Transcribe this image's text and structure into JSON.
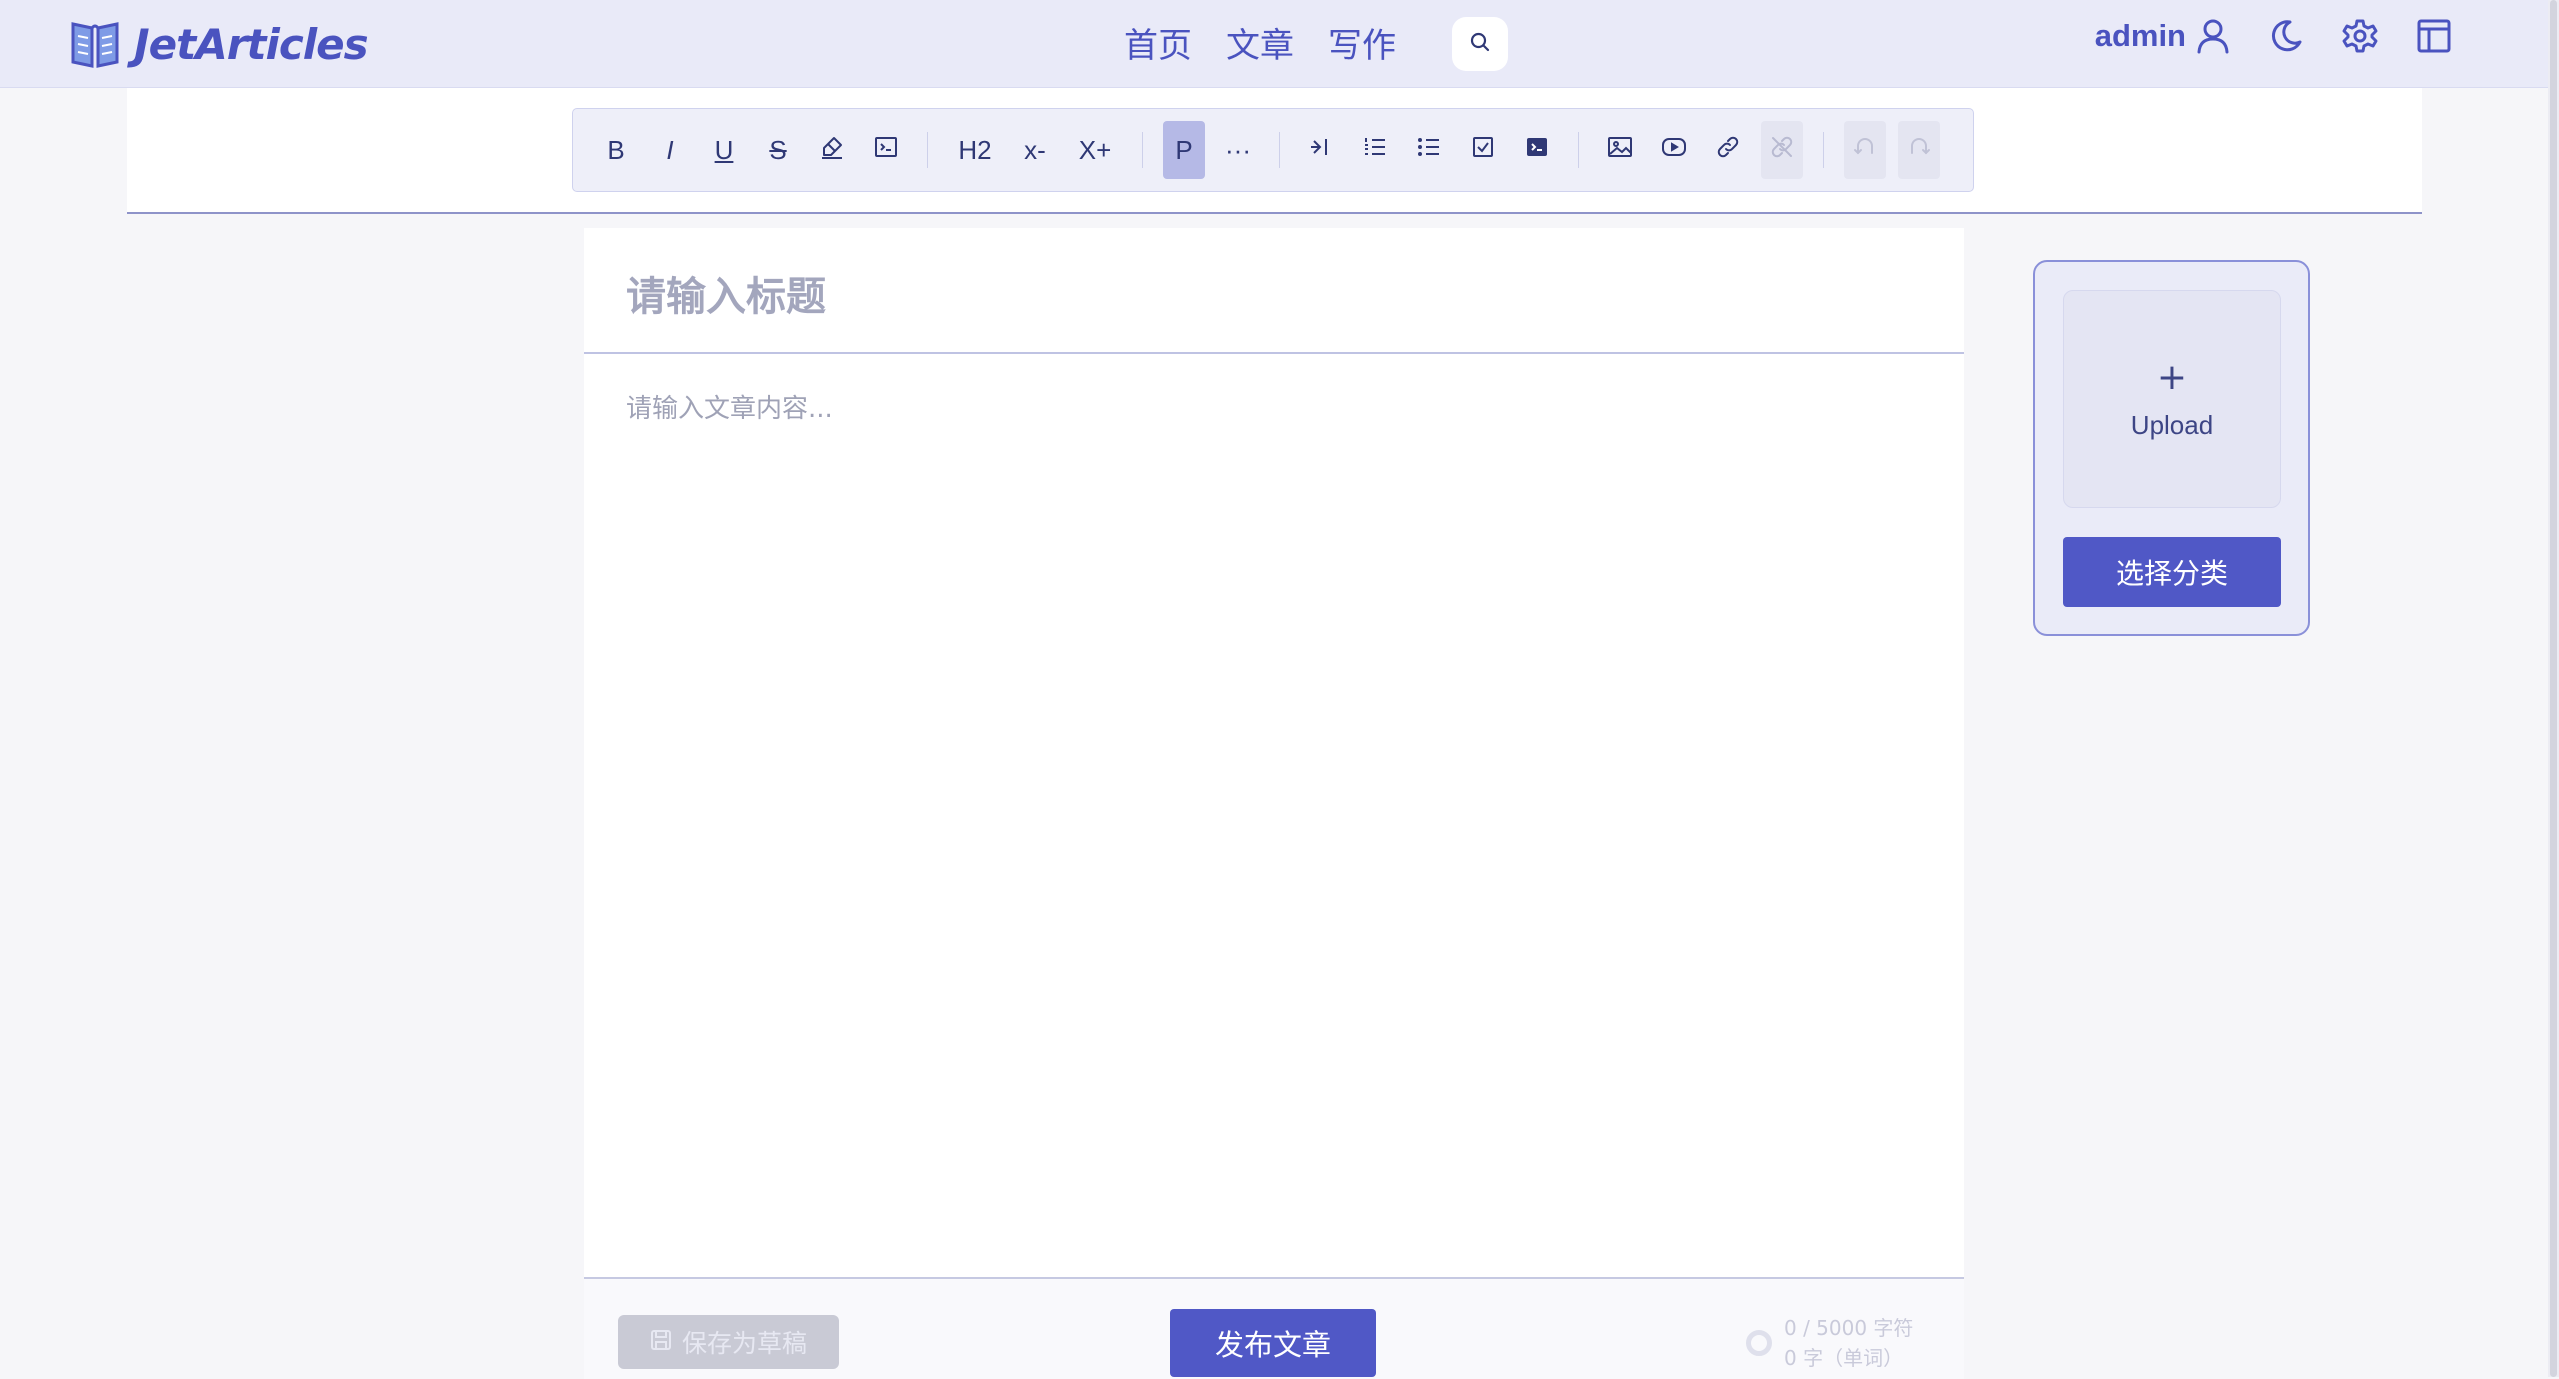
{
  "app": {
    "name": "JetArticles"
  },
  "nav": {
    "links": [
      "首页",
      "文章",
      "写作"
    ],
    "user": "admin"
  },
  "icons": {
    "logo": "book-icon",
    "search": "search-icon",
    "user": "user-icon",
    "theme": "moon-icon",
    "settings": "gear-icon",
    "layout": "layout-icon"
  },
  "colors": {
    "accent": "#5058c6",
    "brand": "#4a53bf",
    "nav_bg": "#e9eaf8"
  },
  "toolbar": {
    "bold": "B",
    "italic": "I",
    "underline": "U",
    "strike": "S",
    "heading": "H2",
    "font_smaller": "x-",
    "font_larger": "X+",
    "paragraph": "P",
    "hr": "···"
  },
  "editor": {
    "title_placeholder": "请输入标题",
    "content_placeholder": "请输入文章内容..."
  },
  "footer": {
    "save_draft": "保存为草稿",
    "publish": "发布文章",
    "char_count": "0 / 5000 字符",
    "word_count": "0 字（单词）"
  },
  "side": {
    "upload_plus": "+",
    "upload_label": "Upload",
    "category_button": "选择分类"
  }
}
